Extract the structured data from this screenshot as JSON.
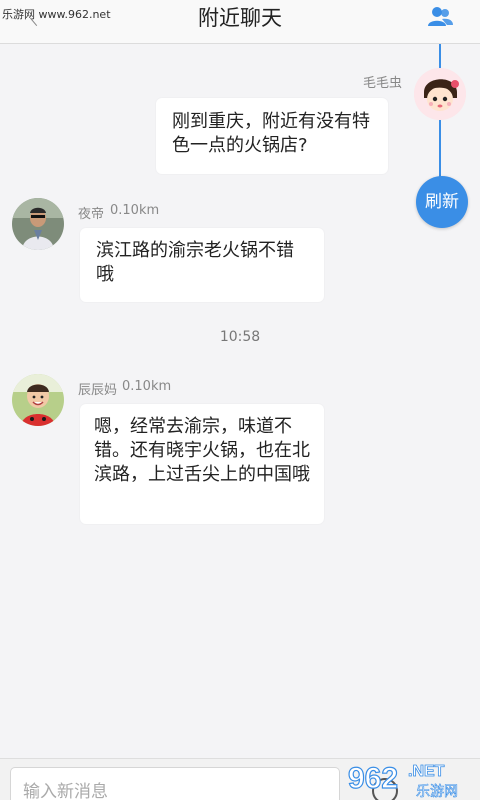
{
  "watermark_top": "乐游网 www.962.net",
  "header": {
    "title": "附近聊天"
  },
  "refresh_label": "刷新",
  "messages": [
    {
      "author": "毛毛虫",
      "text": "刚到重庆，附近有没有特色一点的火锅店?"
    },
    {
      "author": "夜帝",
      "distance": "0.10km",
      "text": "滨江路的渝宗老火锅不错哦"
    },
    {
      "author": "辰辰妈",
      "distance": "0.10km",
      "text": "嗯，经常去渝宗，味道不错。还有晓宇火锅，也在北滨路，上过舌尖上的中国哦"
    }
  ],
  "time_divider": "10:58",
  "input": {
    "placeholder": "输入新消息"
  },
  "watermark_logo": {
    "number": "962",
    "net": ".NET",
    "site": "乐游网"
  },
  "colors": {
    "accent": "#3a8ee6",
    "background": "#f4f4f6"
  },
  "icons": [
    "contacts-icon",
    "back-icon",
    "emoji-icon"
  ]
}
